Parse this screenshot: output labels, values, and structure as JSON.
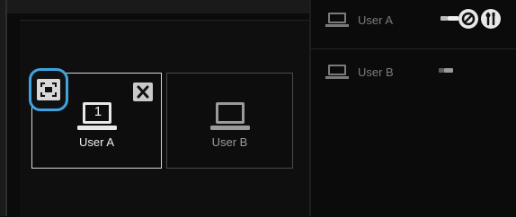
{
  "tiles": [
    {
      "label": "User A",
      "screen_number": "1",
      "selected": true
    },
    {
      "label": "User B",
      "selected": false
    }
  ],
  "user_list": [
    {
      "name": "User A"
    },
    {
      "name": "User B"
    }
  ],
  "colors": {
    "accent": "#3fa3e0",
    "selected_border": "#d8d8d8",
    "unselected_border": "#4a4a4a",
    "muted_text": "#7b7b7b"
  },
  "icons": {
    "fullscreen": "fullscreen-icon",
    "close": "close-icon",
    "laptop": "laptop-icon",
    "block": "block-icon",
    "tools": "tools-icon"
  }
}
